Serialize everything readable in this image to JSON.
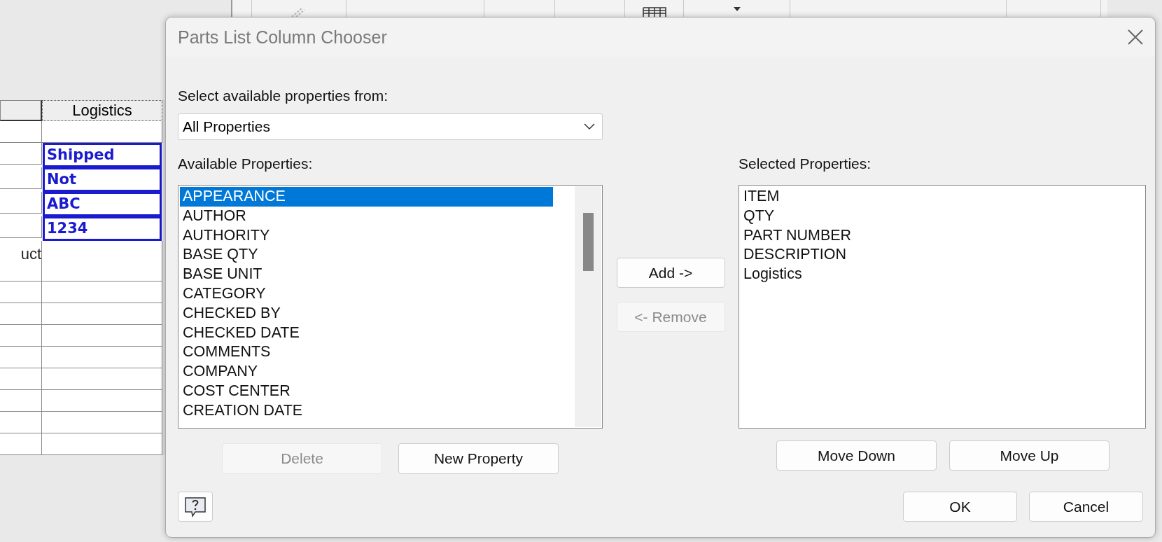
{
  "parts_table": {
    "header": "Logistics",
    "rows": [
      {
        "highlighted": false
      },
      {
        "logistics": "Shipped",
        "highlighted": true
      },
      {
        "logistics": "Not",
        "highlighted": true
      },
      {
        "logistics": "ABC",
        "highlighted": true
      },
      {
        "logistics": "1234",
        "highlighted": true
      },
      {
        "column_1": "uct",
        "highlighted": false
      },
      {
        "highlighted": false
      },
      {
        "highlighted": false
      },
      {
        "highlighted": false
      },
      {
        "highlighted": false
      },
      {
        "highlighted": false
      },
      {
        "highlighted": false
      },
      {
        "highlighted": false
      },
      {
        "highlighted": false
      }
    ]
  },
  "dialog": {
    "title": "Parts List Column Chooser",
    "source_label": "Select available properties from:",
    "source_value": "All Properties",
    "available_label": "Available Properties:",
    "available": [
      {
        "label": "APPEARANCE",
        "selected": true
      },
      {
        "label": "AUTHOR",
        "selected": false
      },
      {
        "label": "AUTHORITY",
        "selected": false
      },
      {
        "label": "BASE QTY",
        "selected": false
      },
      {
        "label": "BASE UNIT",
        "selected": false
      },
      {
        "label": "CATEGORY",
        "selected": false
      },
      {
        "label": "CHECKED BY",
        "selected": false
      },
      {
        "label": "CHECKED DATE",
        "selected": false
      },
      {
        "label": "COMMENTS",
        "selected": false
      },
      {
        "label": "COMPANY",
        "selected": false
      },
      {
        "label": "COST CENTER",
        "selected": false
      },
      {
        "label": "CREATION DATE",
        "selected": false
      }
    ],
    "selected_label": "Selected Properties:",
    "selected_items": [
      {
        "label": "ITEM",
        "selected": false
      },
      {
        "label": "QTY",
        "selected": false
      },
      {
        "label": "PART NUMBER",
        "selected": false
      },
      {
        "label": "DESCRIPTION",
        "selected": false
      },
      {
        "label": "Logistics",
        "selected": false
      }
    ],
    "buttons": [
      {
        "kind": "add",
        "label": "Add ->",
        "disabled": false
      },
      {
        "kind": "remove",
        "label": "<- Remove",
        "disabled": true
      },
      {
        "kind": "delete",
        "label": "Delete",
        "disabled": true
      },
      {
        "kind": "new",
        "label": "New Property",
        "disabled": false
      },
      {
        "kind": "down",
        "label": "Move Down",
        "disabled": false
      },
      {
        "kind": "up",
        "label": "Move Up",
        "disabled": false
      },
      {
        "kind": "ok",
        "label": "OK",
        "disabled": false
      },
      {
        "kind": "cancel",
        "label": "Cancel",
        "disabled": false
      }
    ]
  }
}
